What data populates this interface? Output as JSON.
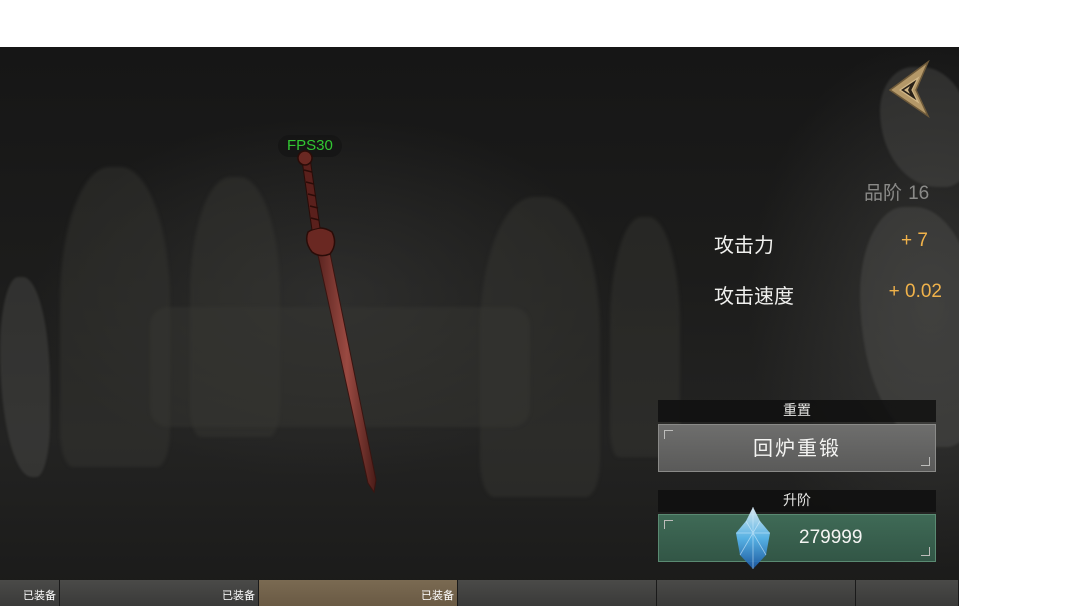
{
  "hud": {
    "fps": "FPS30"
  },
  "navigation": {
    "back_icon": "winged-emblem-icon"
  },
  "item": {
    "grade_label": "品阶",
    "grade_value": "16",
    "stats": [
      {
        "label": "攻击力",
        "value": "+ 7"
      },
      {
        "label": "攻击速度",
        "value": "+ 0.02"
      }
    ]
  },
  "reset": {
    "header": "重置",
    "button_label": "回炉重锻"
  },
  "upgrade": {
    "header": "升阶",
    "cost": "279999",
    "currency_icon": "blue-crystal-icon"
  },
  "slots": [
    {
      "tag": "已装备",
      "active": false
    },
    {
      "tag": "已装备",
      "active": false
    },
    {
      "tag": "已装备",
      "active": true
    },
    {
      "tag": "",
      "active": false
    },
    {
      "tag": "",
      "active": false
    },
    {
      "tag": "",
      "active": false
    }
  ],
  "colors": {
    "stat_value": "#f0b24a",
    "fps_text": "#32c832",
    "upgrade_button": "#3f6a56",
    "reset_button": "#6e6e6d"
  }
}
